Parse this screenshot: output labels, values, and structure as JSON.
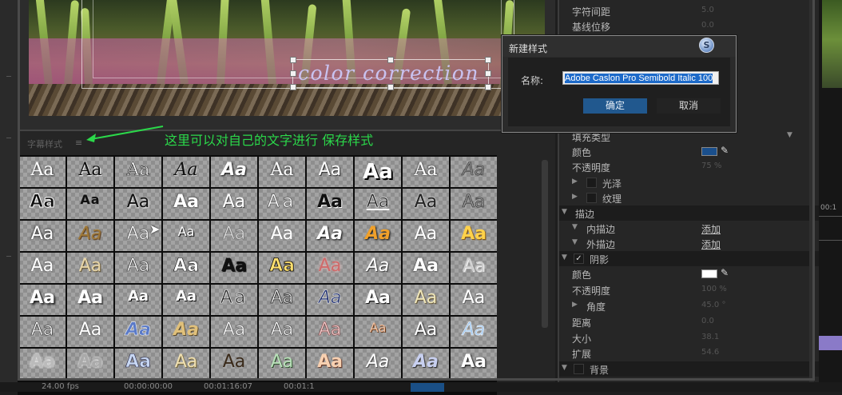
{
  "monitor": {
    "title_text": "color correction"
  },
  "styles_panel": {
    "title": "字幕样式",
    "menu_icon": "≡",
    "annotation": "这里可以对自己的文字进行 保存样式",
    "swatch_text": "Aa"
  },
  "properties": {
    "rows": {
      "char_spacing": {
        "label": "字符间距",
        "value": "5.0"
      },
      "baseline": {
        "label": "基线位移",
        "value": "0.0"
      },
      "fill_type": {
        "label": "填充类型"
      },
      "fill_color": {
        "label": "颜色",
        "color": "#1a4f8c"
      },
      "fill_opacity": {
        "label": "不透明度",
        "value": "75 %"
      },
      "sheen": {
        "label": "光泽"
      },
      "texture": {
        "label": "纹理"
      },
      "stroke": {
        "label": "描边"
      },
      "inner_stroke": {
        "label": "内描边",
        "link": "添加"
      },
      "outer_stroke": {
        "label": "外描边",
        "link": "添加"
      },
      "shadow": {
        "label": "阴影",
        "check": "✓"
      },
      "shadow_color": {
        "label": "颜色",
        "color": "#ffffff"
      },
      "shadow_opacity": {
        "label": "不透明度",
        "value": "100 %"
      },
      "angle": {
        "label": "角度",
        "value": "45.0 °"
      },
      "distance": {
        "label": "距离",
        "value": "0.0"
      },
      "size": {
        "label": "大小",
        "value": "38.1"
      },
      "spread": {
        "label": "扩展",
        "value": "54.6"
      },
      "background": {
        "label": "背景"
      }
    }
  },
  "dialog": {
    "title": "新建样式",
    "name_label": "名称:",
    "name_value": "Adobe Caslon Pro Semibold Italic 100",
    "ok_label": "确定",
    "cancel_label": "取消"
  },
  "status_bar": {
    "fps": "24.00 fps",
    "tc1": "00:00:00:00",
    "tc2": "00:01:16:07",
    "tc3": "00:01:1",
    "right_timecode": "00:1"
  },
  "icons": {
    "panel_menu": "hamburger-menu-icon",
    "eyedropper": "eyedropper-icon",
    "dialog_icon": "app-logo-icon",
    "expand": "triangle-expand-icon"
  }
}
